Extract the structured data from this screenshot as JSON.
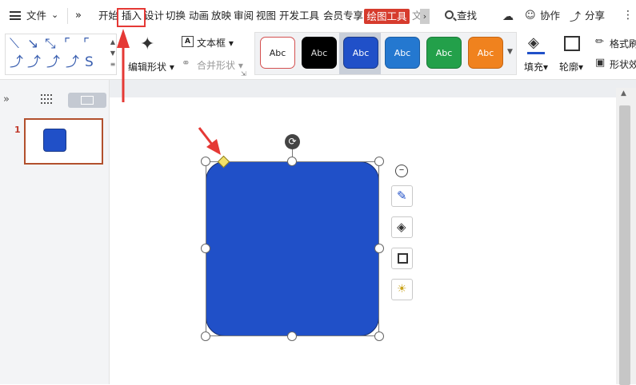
{
  "menu": {
    "file": "文件",
    "tabs": [
      "开始",
      "插入",
      "设计",
      "切换",
      "动画",
      "放映",
      "审阅",
      "视图",
      "开发工具",
      "会员专享"
    ],
    "active_tab": "绘图工具",
    "search": "查找",
    "collaborate": "协作",
    "share": "分享"
  },
  "ribbon": {
    "edit_shape": "编辑形状",
    "text_box": "文本框",
    "merge_shape": "合并形状",
    "style_label": "Abc",
    "style_swatches": [
      {
        "fill": "#ffffff",
        "border": "#d45050",
        "text": "#222222"
      },
      {
        "fill": "#000000",
        "border": "#000000",
        "text": "#dddddd"
      },
      {
        "fill": "#2050c8",
        "border": "#1a3a8a",
        "text": "#ffffff"
      },
      {
        "fill": "#2478d0",
        "border": "#1c5ea2",
        "text": "#ffffff"
      },
      {
        "fill": "#23a04a",
        "border": "#1b7a38",
        "text": "#ffffff"
      },
      {
        "fill": "#f0821e",
        "border": "#c46614",
        "text": "#ffffff"
      }
    ],
    "fill": "填充",
    "outline": "轮廓",
    "format_painter": "格式刷",
    "shape_effect": "形状效"
  },
  "slides": {
    "number": "1"
  },
  "colors": {
    "accent_red": "#e53935",
    "drawing_tools_tab": "#d63b2d",
    "shape_fill": "#2050c8"
  }
}
